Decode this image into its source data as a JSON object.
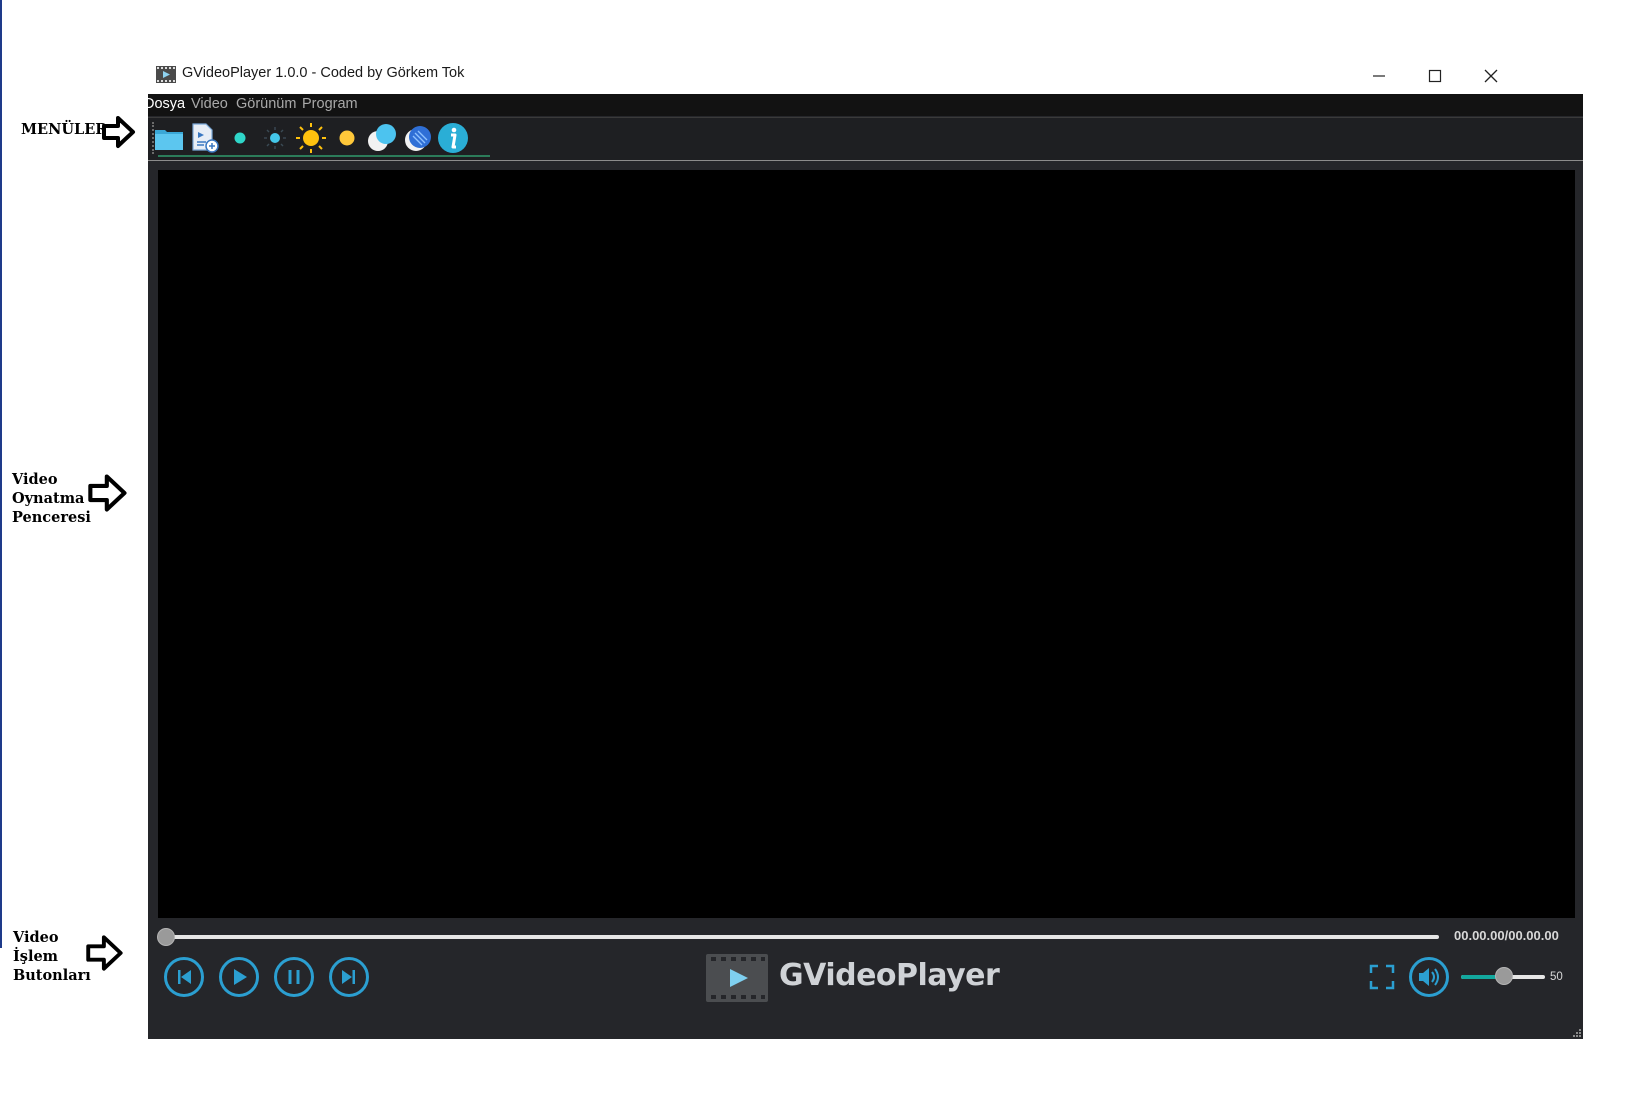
{
  "annotations": {
    "menus": "MENÜLER",
    "video_window": [
      "Video",
      "Oynatma",
      "Penceresi"
    ],
    "video_buttons": [
      "Video",
      "İşlem",
      "Butonları"
    ]
  },
  "window": {
    "title": "GVideoPlayer 1.0.0 - Coded by Görkem Tok",
    "controls": [
      "minimize-icon",
      "maximize-icon",
      "close-icon"
    ]
  },
  "menu": {
    "items": [
      "Dosya",
      "Video",
      "Görünüm",
      "Program"
    ],
    "active": "Dosya"
  },
  "toolbar": {
    "icons": [
      "folder-open-icon",
      "add-playlist-icon",
      "small-dot-icon",
      "small-sun-icon",
      "sun-icon",
      "yellow-dot-icon",
      "contrast-icon",
      "color-icon",
      "info-icon"
    ]
  },
  "player": {
    "time": "00.00.00/00.00.00",
    "progress": 0,
    "controls": [
      "previous-icon",
      "play-icon",
      "pause-icon",
      "next-icon"
    ],
    "logo_text": "GVideoPlayer",
    "volume": 50,
    "volume_label": "50"
  },
  "colors": {
    "accent": "#2b9fd1",
    "app_bg": "#25262a",
    "menubar_bg": "#121212",
    "volume_fill": "#13a89e"
  }
}
